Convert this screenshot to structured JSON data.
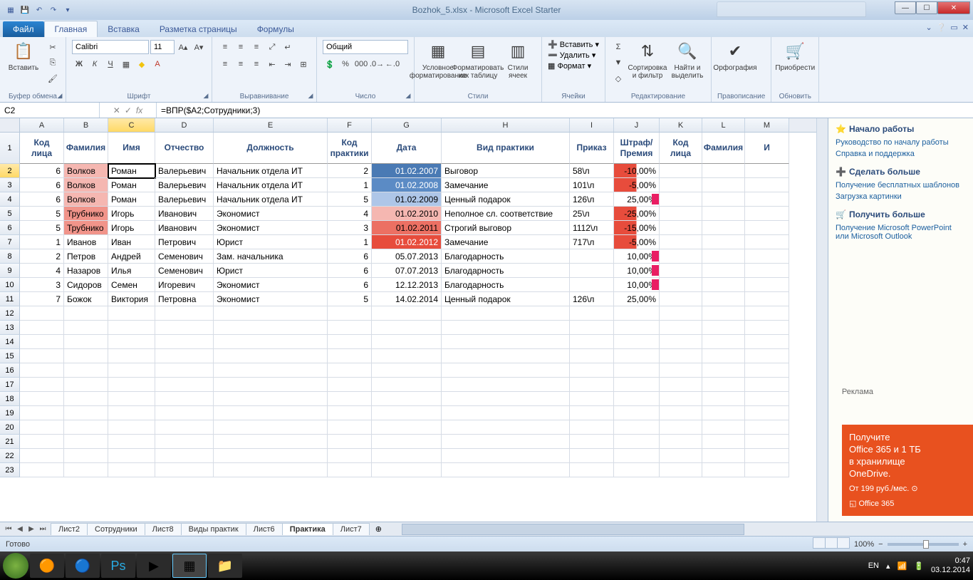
{
  "title": "Bozhok_5.xlsx - Microsoft Excel Starter",
  "ribbon_tabs": {
    "file": "Файл",
    "home": "Главная",
    "insert": "Вставка",
    "layout": "Разметка страницы",
    "formulas": "Формулы"
  },
  "groups": {
    "clipboard": {
      "name": "Буфер обмена",
      "paste": "Вставить"
    },
    "font": {
      "name": "Шрифт",
      "family": "Calibri",
      "size": "11"
    },
    "align": {
      "name": "Выравнивание"
    },
    "number": {
      "name": "Число",
      "format": "Общий"
    },
    "styles": {
      "name": "Стили",
      "cond": "Условное форматирование",
      "table": "Форматировать как таблицу",
      "cell": "Стили ячеек"
    },
    "cells": {
      "name": "Ячейки",
      "insert": "Вставить",
      "delete": "Удалить",
      "format": "Формат"
    },
    "editing": {
      "name": "Редактирование",
      "sort": "Сортировка и фильтр",
      "find": "Найти и выделить"
    },
    "proof": {
      "name": "Правописание",
      "spell": "Орфография"
    },
    "update": {
      "name": "Обновить",
      "buy": "Приобрести"
    }
  },
  "namebox": "C2",
  "formula": "=ВПР($A2;Сотрудники;3)",
  "columns": [
    "A",
    "B",
    "C",
    "D",
    "E",
    "F",
    "G",
    "H",
    "I",
    "J",
    "K",
    "L",
    "M"
  ],
  "col2": [
    "",
    "",
    "",
    "",
    "",
    "",
    "",
    "",
    "",
    "",
    "Код лица",
    "Фамилия",
    "И"
  ],
  "headers": [
    "Код лица",
    "Фамилия",
    "Имя",
    "Отчество",
    "Должность",
    "Код практики",
    "Дата",
    "Вид практики",
    "Приказ",
    "Штраф/ Премия"
  ],
  "rows": [
    {
      "a": "6",
      "b": "Волков",
      "c": "Роман",
      "d": "Валерьевич",
      "e": "Начальник отдела ИТ",
      "f": "2",
      "g": "01.02.2007",
      "h": "Выговор",
      "i": "58\\л",
      "j": "-10,00%",
      "bcl": "bg-red1",
      "gcl": "bg-blue3",
      "jcl": "bar-neg"
    },
    {
      "a": "6",
      "b": "Волков",
      "c": "Роман",
      "d": "Валерьевич",
      "e": "Начальник отдела ИТ",
      "f": "1",
      "g": "01.02.2008",
      "h": "Замечание",
      "i": "101\\л",
      "j": "-5,00%",
      "bcl": "bg-red1",
      "gcl": "bg-blue2",
      "jcl": "bar-neg"
    },
    {
      "a": "6",
      "b": "Волков",
      "c": "Роман",
      "d": "Валерьевич",
      "e": "Начальник отдела ИТ",
      "f": "5",
      "g": "01.02.2009",
      "h": "Ценный подарок",
      "i": "126\\л",
      "j": "25,00%",
      "bcl": "bg-red1",
      "gcl": "bg-blue1",
      "jcl": "pinkbar"
    },
    {
      "a": "5",
      "b": "Трубнико",
      "c": "Игорь",
      "d": "Иванович",
      "e": "Экономист",
      "f": "4",
      "g": "01.02.2010",
      "h": "Неполное сл. соответствие",
      "i": "25\\л",
      "j": "-25,00%",
      "bcl": "bg-red2",
      "gcl": "bg-red1",
      "jcl": "bar-neg"
    },
    {
      "a": "5",
      "b": "Трубнико",
      "c": "Игорь",
      "d": "Иванович",
      "e": "Экономист",
      "f": "3",
      "g": "01.02.2011",
      "h": "Строгий выговор",
      "i": "1112\\л",
      "j": "-15,00%",
      "bcl": "bg-red2",
      "gcl": "bg-red3",
      "jcl": "bar-neg"
    },
    {
      "a": "1",
      "b": "Иванов",
      "c": "Иван",
      "d": "Петрович",
      "e": "Юрист",
      "f": "1",
      "g": "01.02.2012",
      "h": "Замечание",
      "i": "717\\л",
      "j": "-5,00%",
      "bcl": "",
      "gcl": "bg-red4",
      "jcl": "bar-neg"
    },
    {
      "a": "2",
      "b": "Петров",
      "c": "Андрей",
      "d": "Семенович",
      "e": "Зам. начальника",
      "f": "6",
      "g": "05.07.2013",
      "h": "Благодарность",
      "i": "",
      "j": "10,00%",
      "bcl": "",
      "gcl": "",
      "jcl": "pinkbar"
    },
    {
      "a": "4",
      "b": "Назаров",
      "c": "Илья",
      "d": "Семенович",
      "e": "Юрист",
      "f": "6",
      "g": "07.07.2013",
      "h": "Благодарность",
      "i": "",
      "j": "10,00%",
      "bcl": "",
      "gcl": "",
      "jcl": "pinkbar"
    },
    {
      "a": "3",
      "b": "Сидоров",
      "c": "Семен",
      "d": "Игоревич",
      "e": "Экономист",
      "f": "6",
      "g": "12.12.2013",
      "h": "Благодарность",
      "i": "",
      "j": "10,00%",
      "bcl": "",
      "gcl": "",
      "jcl": "pinkbar"
    },
    {
      "a": "7",
      "b": "Божок",
      "c": "Виктория",
      "d": "Петровна",
      "e": "Экономист",
      "f": "5",
      "g": "14.02.2014",
      "h": "Ценный подарок",
      "i": "126\\л",
      "j": "25,00%",
      "bcl": "",
      "gcl": "",
      "jcl": ""
    }
  ],
  "empty_rows": [
    12,
    13,
    14,
    15,
    16,
    17,
    18,
    19,
    20,
    21,
    22,
    23
  ],
  "sheets": [
    "Лист2",
    "Сотрудники",
    "Лист8",
    "Виды практик",
    "Лист6",
    "Практика",
    "Лист7"
  ],
  "active_sheet": "Практика",
  "status": "Готово",
  "zoom": "100%",
  "side": {
    "start": "Начало работы",
    "links1": [
      "Руководство по началу работы",
      "Справка и поддержка"
    ],
    "more": "Сделать больше",
    "links2": [
      "Получение бесплатных шаблонов",
      "Загрузка картинки"
    ],
    "get": "Получить больше",
    "links3": [
      "Получение Microsoft PowerPoint или Microsoft Outlook"
    ],
    "adlabel": "Реклама",
    "ad": {
      "l1": "Получите",
      "l2": "Office 365 и 1 ТБ",
      "l3": "в хранилище",
      "l4": "OneDrive.",
      "l5": "От 199 руб./мес.",
      "brand": "Office 365"
    }
  },
  "tray": {
    "lang": "EN",
    "time": "0:47",
    "date": "03.12.2014"
  }
}
